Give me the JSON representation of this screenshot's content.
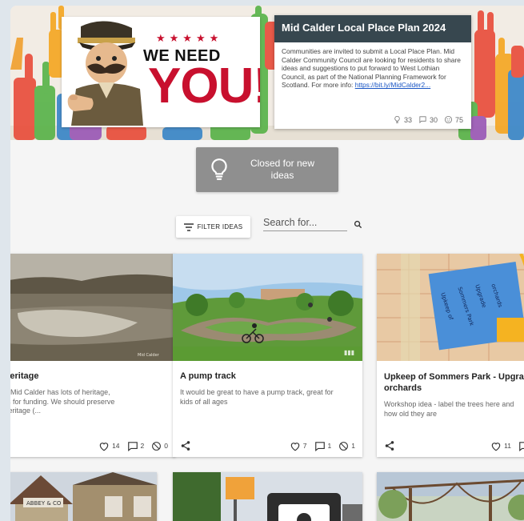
{
  "poster": {
    "we_need": "WE NEED",
    "you": "YOU!",
    "stars": "★★★★★"
  },
  "info_card": {
    "title": "Mid Calder Local Place Plan 2024",
    "body": "Communities are invited to submit a Local Place Plan. Mid Calder Community Council are looking for residents to share ideas and suggestions to put forward to West Lothian Council, as part of the National Planning Framework for Scotland. For more info: ",
    "link": "https://bit.ly/MidCalder2...",
    "ideas": "33",
    "comments": "30",
    "participants": "75"
  },
  "closed_box": {
    "label_line1": "Closed for new",
    "label_line2": "ideas"
  },
  "filter": {
    "label": "FILTER IDEAS"
  },
  "search": {
    "placeholder": "Search for..."
  },
  "cards": [
    {
      "title": "er Heritage",
      "desc_line1": "idea: Mid Calder has lots of heritage,",
      "desc_line2": "doors for funding. We should preserve",
      "desc_line3": "ain heritage (...",
      "likes": "14",
      "comments": "2",
      "dislikes": "0"
    },
    {
      "title": "A pump track",
      "desc_line1": "It would be great to have a pump track, great for",
      "desc_line2": "kids of all ages",
      "likes": "7",
      "comments": "1",
      "dislikes": "1"
    },
    {
      "title_line1": "Upkeep of Sommers Park - Upgra",
      "title_line2": "orchards",
      "desc_line1": "Workshop idea - label the trees here and",
      "desc_line2": "how old they are",
      "likes": "11",
      "note_text": "Upkeep of Sommers Park Upgrade orchards"
    }
  ],
  "bottom_cards": {
    "sign_text": "ABBEY & CO"
  },
  "colors": {
    "header_dark": "#37474f",
    "closed_grey": "#8f8f8f",
    "poster_red": "#c8102e",
    "link_blue": "#1a56c4"
  }
}
